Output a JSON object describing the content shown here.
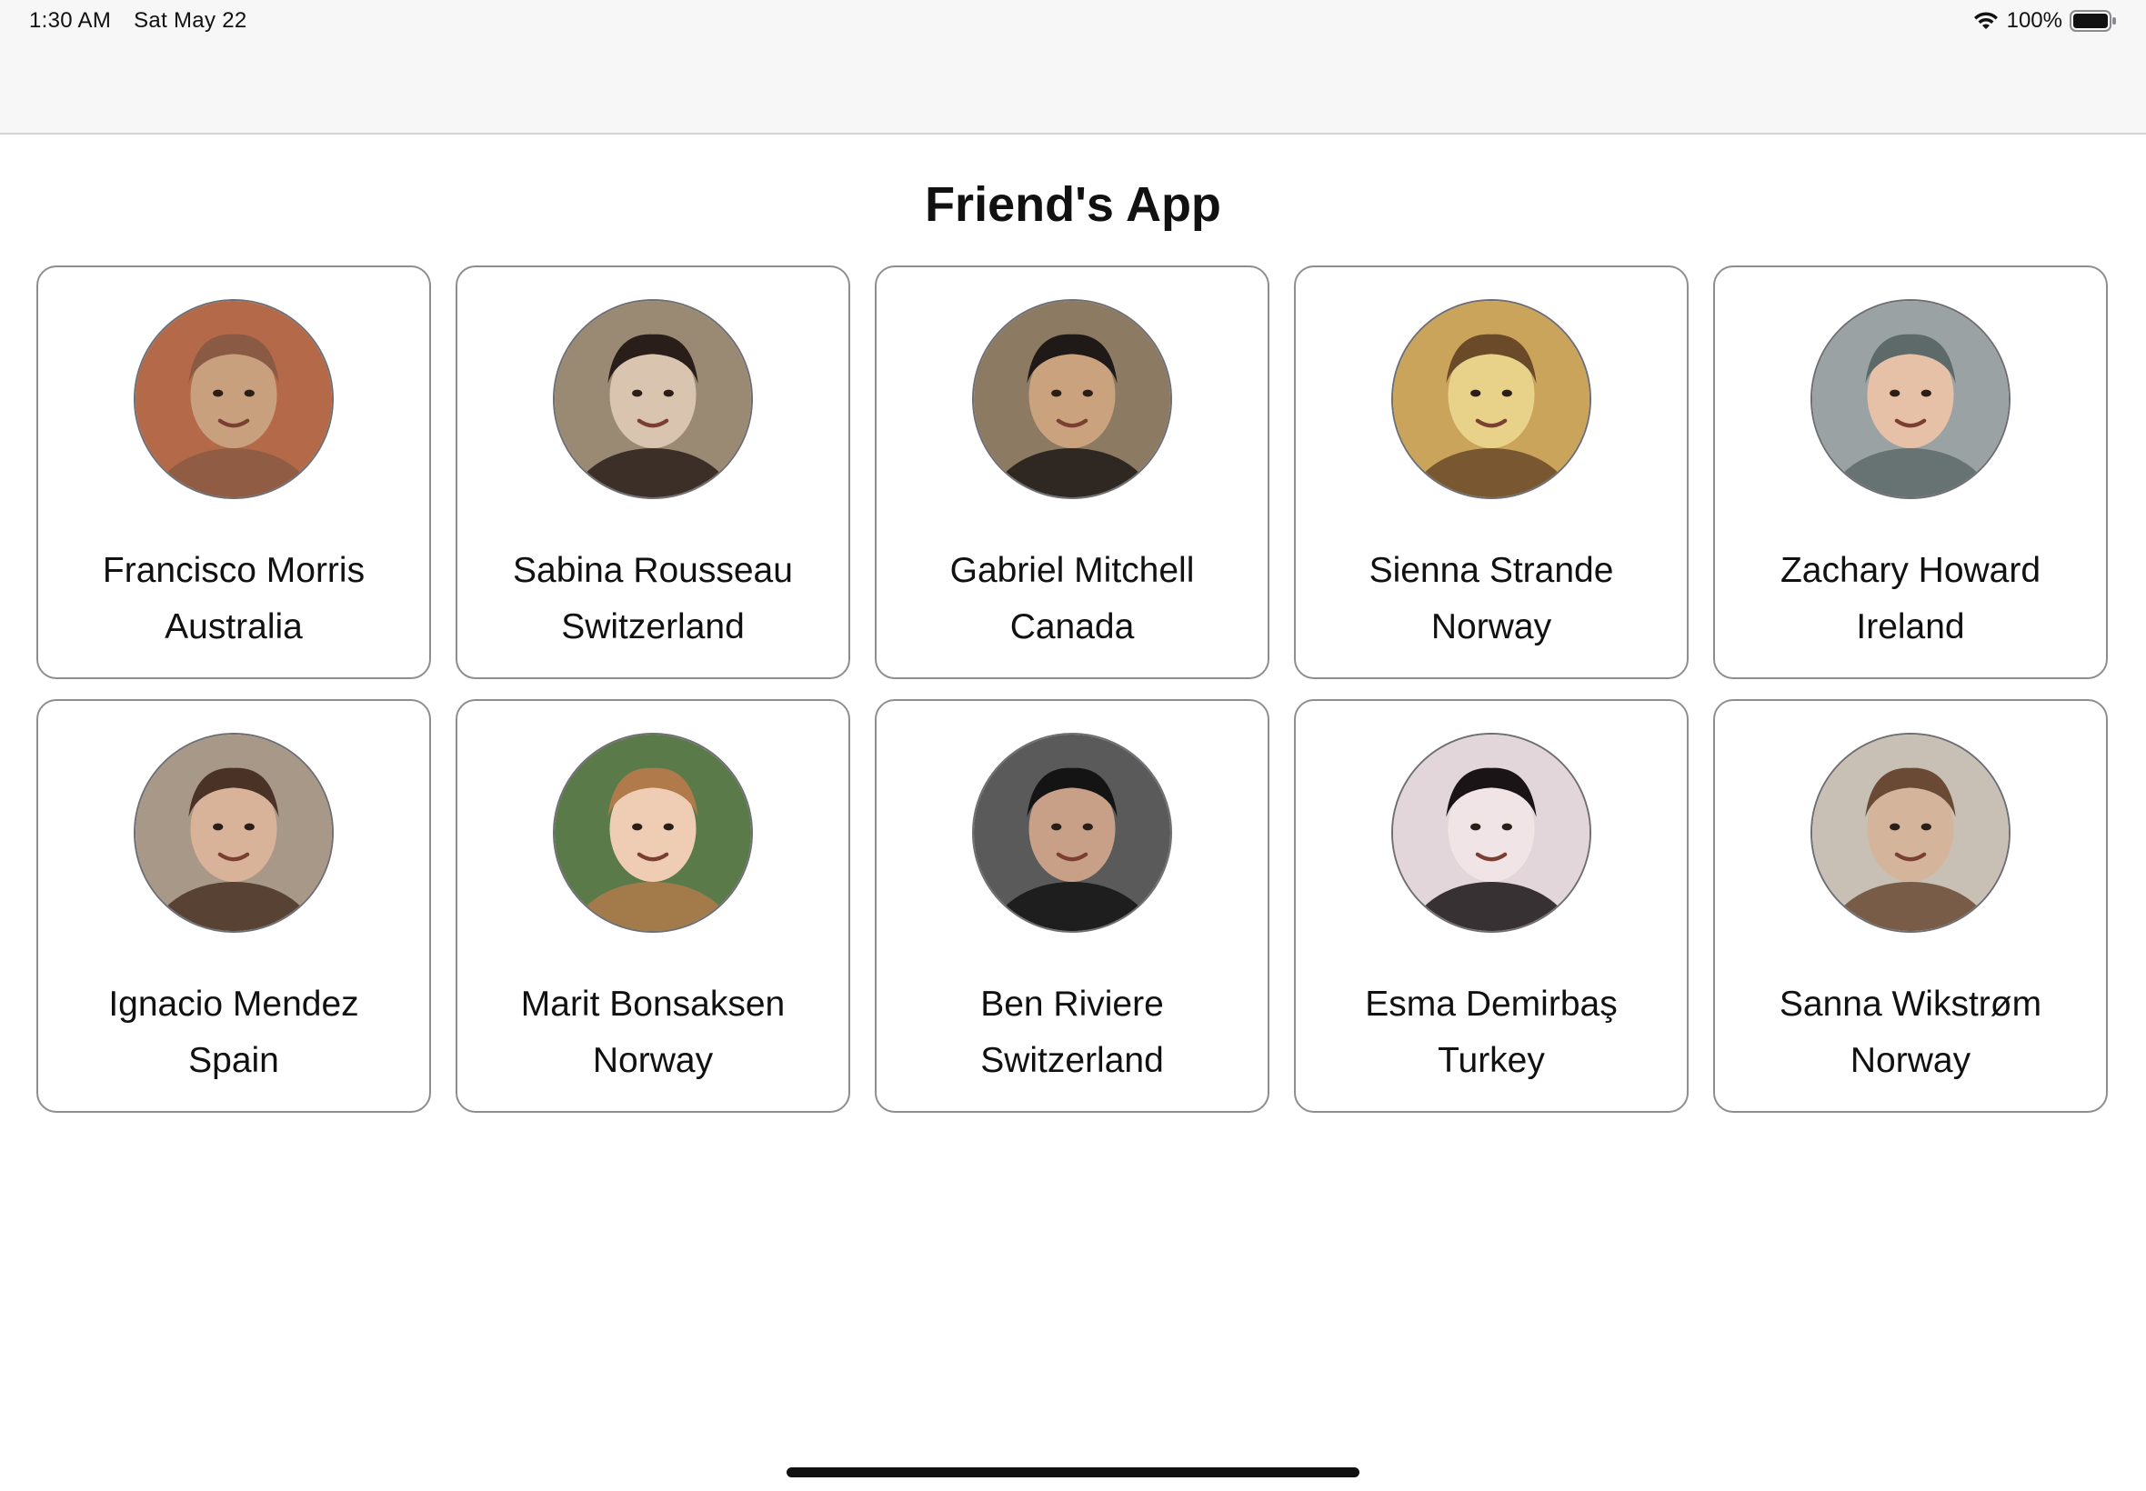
{
  "status_bar": {
    "time": "1:30 AM",
    "date": "Sat May 22",
    "battery": "100%",
    "icons": [
      "wifi-icon",
      "battery-icon"
    ]
  },
  "title": "Friend's App",
  "friends": [
    {
      "name": "Francisco Morris",
      "country": "Australia",
      "avatar_colors": [
        "#c9a07e",
        "#8a5a44",
        "#b46a48"
      ]
    },
    {
      "name": "Sabina Rousseau",
      "country": "Switzerland",
      "avatar_colors": [
        "#d9c4b0",
        "#2a1e1a",
        "#9a8a74"
      ]
    },
    {
      "name": "Gabriel Mitchell",
      "country": "Canada",
      "avatar_colors": [
        "#caa27e",
        "#1f1a17",
        "#8c7a62"
      ]
    },
    {
      "name": "Sienna Strande",
      "country": "Norway",
      "avatar_colors": [
        "#e8d28a",
        "#6b4a2a",
        "#c9a45a"
      ]
    },
    {
      "name": "Zachary Howard",
      "country": "Ireland",
      "avatar_colors": [
        "#e6c1a8",
        "#5e6a6a",
        "#9aa2a4"
      ]
    },
    {
      "name": "Ignacio Mendez",
      "country": "Spain",
      "avatar_colors": [
        "#d8b39a",
        "#4a3226",
        "#a89888"
      ]
    },
    {
      "name": "Marit Bonsaksen",
      "country": "Norway",
      "avatar_colors": [
        "#efcdb4",
        "#b07a4a",
        "#5a7a4a"
      ]
    },
    {
      "name": "Ben Riviere",
      "country": "Switzerland",
      "avatar_colors": [
        "#c8a088",
        "#141414",
        "#5a5a5a"
      ]
    },
    {
      "name": "Esma Demirbaş",
      "country": "Turkey",
      "avatar_colors": [
        "#f1e4e6",
        "#1a1416",
        "#e2d6da"
      ]
    },
    {
      "name": "Sanna Wikstrøm",
      "country": "Norway",
      "avatar_colors": [
        "#d4b49a",
        "#6a4a34",
        "#c8c0b4"
      ]
    }
  ]
}
